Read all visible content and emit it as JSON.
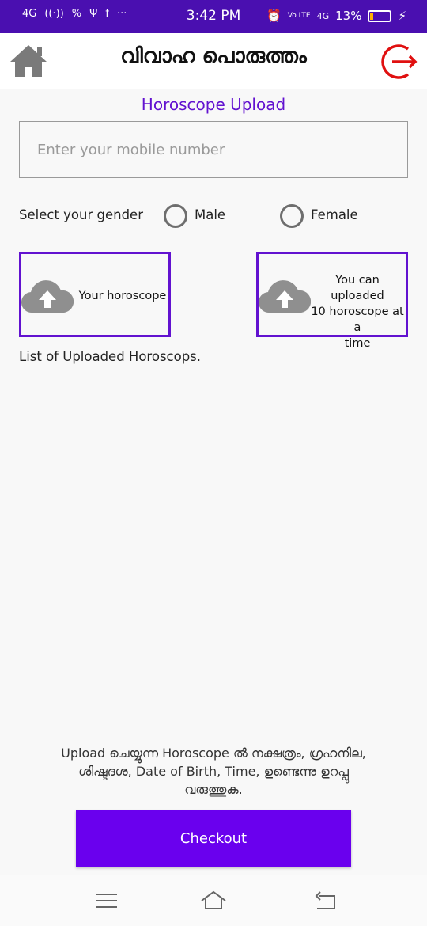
{
  "status_bar": {
    "time": "3:42 PM",
    "network_left": "4G",
    "hotspot": "((·))",
    "data_saver": "%",
    "usb": "Ψ",
    "facebook": "f",
    "more": "···",
    "volte": "Vo LTE",
    "network_right": "4G",
    "battery": "13%"
  },
  "app_bar": {
    "title": "വിവാഹ പൊരുത്തം",
    "home_icon": "home-icon",
    "logout_icon": "logout-icon",
    "logout_color": "#e01010"
  },
  "section_title": "Horoscope Upload",
  "mobile_input": {
    "placeholder": "Enter your mobile number",
    "value": ""
  },
  "gender": {
    "label": "Select your gender",
    "options": [
      "Male",
      "Female"
    ],
    "selected": null
  },
  "upload": {
    "single_label": "Your horoscope",
    "multi_label_line1": "You can uploaded",
    "multi_label_line2": "10 horoscope at a",
    "multi_label_line3": "time",
    "icon": "cloud-upload-icon"
  },
  "list_title": "List of Uploaded Horoscops.",
  "note": {
    "line1": "Upload ചെയ്യുന്ന Horoscope ൽ നക്ഷത്രം, ഗ്രഹനില,",
    "line2": "ശിഷ്ടദശ, Date of Birth, Time, ഉണ്ടെന്നു ഉറപ്പു",
    "line3": "വരുത്തുക."
  },
  "checkout_label": "Checkout",
  "colors": {
    "status_bar": "#4a0fb0",
    "accent": "#6212d0",
    "button": "#6a00ee"
  },
  "nav_bar": {
    "icons": [
      "menu-icon",
      "home-nav-icon",
      "back-icon"
    ]
  }
}
